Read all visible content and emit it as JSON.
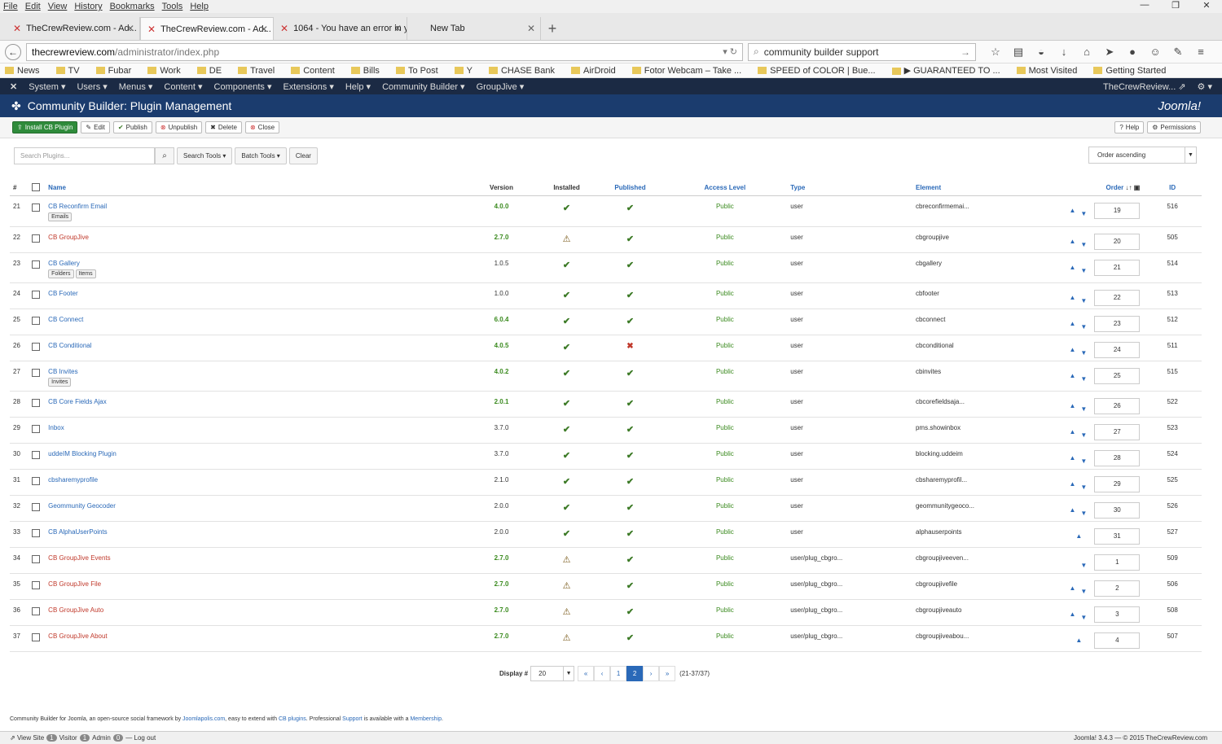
{
  "browser": {
    "menu": [
      "File",
      "Edit",
      "View",
      "History",
      "Bookmarks",
      "Tools",
      "Help"
    ],
    "tabs": [
      {
        "label": "TheCrewReview.com - Ad...",
        "active": false
      },
      {
        "label": "TheCrewReview.com - Ad...",
        "active": true
      },
      {
        "label": "1064 - You have an error in yo...",
        "active": false
      },
      {
        "label": "New Tab",
        "active": false
      }
    ],
    "url_host": "thecrewreview.com",
    "url_path": "/administrator/index.php",
    "search": "community builder support",
    "bookmarks": [
      "News",
      "TV",
      "Fubar",
      "Work",
      "DE",
      "Travel",
      "Content",
      "Bills",
      "To Post",
      "Y",
      "CHASE Bank",
      "AirDroid",
      "Fotor Webcam – Take ...",
      "SPEED of COLOR | Bue...",
      "▶ GUARANTEED TO ...",
      "Most Visited",
      "Getting Started"
    ]
  },
  "joomla": {
    "menu": [
      "System",
      "Users",
      "Menus",
      "Content",
      "Components",
      "Extensions",
      "Help",
      "Community Builder",
      "GroupJive"
    ],
    "site": "TheCrewReview...",
    "title": "Community Builder: Plugin Management",
    "logo": "Joomla!"
  },
  "toolbar": {
    "install": "Install CB Plugin",
    "edit": "Edit",
    "publish": "Publish",
    "unpublish": "Unpublish",
    "delete": "Delete",
    "close": "Close",
    "help": "Help",
    "permissions": "Permissions"
  },
  "filters": {
    "search_placeholder": "Search Plugins...",
    "search_tools": "Search Tools",
    "batch_tools": "Batch Tools",
    "clear": "Clear",
    "ordering": "Order ascending"
  },
  "columns": {
    "num": "#",
    "name": "Name",
    "version": "Version",
    "installed": "Installed",
    "published": "Published",
    "access": "Access Level",
    "type": "Type",
    "element": "Element",
    "order": "Order",
    "id": "ID"
  },
  "rows": [
    {
      "n": "21",
      "name": "CB Reconfirm Email",
      "red": false,
      "tags": [
        "Emails"
      ],
      "ver": "4.0.0",
      "vg": true,
      "inst": "ok",
      "pub": "ok",
      "acc": "Public",
      "type": "user",
      "el": "cbreconfirmemai...",
      "up": true,
      "down": true,
      "ord": "19",
      "id": "516"
    },
    {
      "n": "22",
      "name": "CB GroupJive",
      "red": true,
      "tags": [],
      "ver": "2.7.0",
      "vg": true,
      "inst": "warn",
      "pub": "ok",
      "acc": "Public",
      "type": "user",
      "el": "cbgroupjive",
      "up": true,
      "down": true,
      "ord": "20",
      "id": "505"
    },
    {
      "n": "23",
      "name": "CB Gallery",
      "red": false,
      "tags": [
        "Folders",
        "Items"
      ],
      "ver": "1.0.5",
      "vg": false,
      "inst": "ok",
      "pub": "ok",
      "acc": "Public",
      "type": "user",
      "el": "cbgallery",
      "up": true,
      "down": true,
      "ord": "21",
      "id": "514"
    },
    {
      "n": "24",
      "name": "CB Footer",
      "red": false,
      "tags": [],
      "ver": "1.0.0",
      "vg": false,
      "inst": "ok",
      "pub": "ok",
      "acc": "Public",
      "type": "user",
      "el": "cbfooter",
      "up": true,
      "down": true,
      "ord": "22",
      "id": "513"
    },
    {
      "n": "25",
      "name": "CB Connect",
      "red": false,
      "tags": [],
      "ver": "6.0.4",
      "vg": true,
      "inst": "ok",
      "pub": "ok",
      "acc": "Public",
      "type": "user",
      "el": "cbconnect",
      "up": true,
      "down": true,
      "ord": "23",
      "id": "512"
    },
    {
      "n": "26",
      "name": "CB Conditional",
      "red": false,
      "tags": [],
      "ver": "4.0.5",
      "vg": true,
      "inst": "ok",
      "pub": "err",
      "acc": "Public",
      "type": "user",
      "el": "cbconditional",
      "up": true,
      "down": true,
      "ord": "24",
      "id": "511"
    },
    {
      "n": "27",
      "name": "CB Invites",
      "red": false,
      "tags": [
        "Invites"
      ],
      "ver": "4.0.2",
      "vg": true,
      "inst": "ok",
      "pub": "ok",
      "acc": "Public",
      "type": "user",
      "el": "cbinvites",
      "up": true,
      "down": true,
      "ord": "25",
      "id": "515"
    },
    {
      "n": "28",
      "name": "CB Core Fields Ajax",
      "red": false,
      "tags": [],
      "ver": "2.0.1",
      "vg": true,
      "inst": "ok",
      "pub": "ok",
      "acc": "Public",
      "type": "user",
      "el": "cbcorefieldsaja...",
      "up": true,
      "down": true,
      "ord": "26",
      "id": "522"
    },
    {
      "n": "29",
      "name": "Inbox",
      "red": false,
      "tags": [],
      "ver": "3.7.0",
      "vg": false,
      "inst": "ok",
      "pub": "ok",
      "acc": "Public",
      "type": "user",
      "el": "pms.showinbox",
      "up": true,
      "down": true,
      "ord": "27",
      "id": "523"
    },
    {
      "n": "30",
      "name": "uddeIM Blocking Plugin",
      "red": false,
      "tags": [],
      "ver": "3.7.0",
      "vg": false,
      "inst": "ok",
      "pub": "ok",
      "acc": "Public",
      "type": "user",
      "el": "blocking.uddeim",
      "up": true,
      "down": true,
      "ord": "28",
      "id": "524"
    },
    {
      "n": "31",
      "name": "cbsharemyprofile",
      "red": false,
      "tags": [],
      "ver": "2.1.0",
      "vg": false,
      "inst": "ok",
      "pub": "ok",
      "acc": "Public",
      "type": "user",
      "el": "cbsharemyprofil...",
      "up": true,
      "down": true,
      "ord": "29",
      "id": "525"
    },
    {
      "n": "32",
      "name": "Geommunity Geocoder",
      "red": false,
      "tags": [],
      "ver": "2.0.0",
      "vg": false,
      "inst": "ok",
      "pub": "ok",
      "acc": "Public",
      "type": "user",
      "el": "geommunitygeoco...",
      "up": true,
      "down": true,
      "ord": "30",
      "id": "526"
    },
    {
      "n": "33",
      "name": "CB AlphaUserPoints",
      "red": false,
      "tags": [],
      "ver": "2.0.0",
      "vg": false,
      "inst": "ok",
      "pub": "ok",
      "acc": "Public",
      "type": "user",
      "el": "alphauserpoints",
      "up": true,
      "down": false,
      "ord": "31",
      "id": "527"
    },
    {
      "n": "34",
      "name": "CB GroupJive Events",
      "red": true,
      "tags": [],
      "ver": "2.7.0",
      "vg": true,
      "inst": "warn",
      "pub": "ok",
      "acc": "Public",
      "type": "user/plug_cbgro...",
      "el": "cbgroupjiveeven...",
      "up": false,
      "down": true,
      "ord": "1",
      "id": "509"
    },
    {
      "n": "35",
      "name": "CB GroupJive File",
      "red": true,
      "tags": [],
      "ver": "2.7.0",
      "vg": true,
      "inst": "warn",
      "pub": "ok",
      "acc": "Public",
      "type": "user/plug_cbgro...",
      "el": "cbgroupjivefile",
      "up": true,
      "down": true,
      "ord": "2",
      "id": "506"
    },
    {
      "n": "36",
      "name": "CB GroupJive Auto",
      "red": true,
      "tags": [],
      "ver": "2.7.0",
      "vg": true,
      "inst": "warn",
      "pub": "ok",
      "acc": "Public",
      "type": "user/plug_cbgro...",
      "el": "cbgroupjiveauto",
      "up": true,
      "down": true,
      "ord": "3",
      "id": "508"
    },
    {
      "n": "37",
      "name": "CB GroupJive About",
      "red": true,
      "tags": [],
      "ver": "2.7.0",
      "vg": true,
      "inst": "warn",
      "pub": "ok",
      "acc": "Public",
      "type": "user/plug_cbgro...",
      "el": "cbgroupjiveabou...",
      "up": true,
      "down": false,
      "ord": "4",
      "id": "507"
    }
  ],
  "pagination": {
    "label": "Display #",
    "limit": "20",
    "pages": [
      "«",
      "‹",
      "1",
      "2",
      "›",
      "»"
    ],
    "active": "2",
    "range": "(21-37/37)"
  },
  "footer": {
    "t1": "Community Builder for Joomla, an open-source social framework by ",
    "l1": "Joomlapolis.com",
    "t2": ", easy to extend with ",
    "l2": "CB plugins",
    "t3": ". Professional ",
    "l3": "Support",
    "t4": " is available with a ",
    "l4": "Membership",
    "t5": "."
  },
  "status": {
    "view_site": "View Site",
    "visitors_count": "1",
    "visitor": "Visitor",
    "admins_count": "1",
    "admin": "Admin",
    "msgs_count": "0",
    "logout": "Log out",
    "version": "Joomla! 3.4.3 — © 2015 TheCrewReview.com"
  }
}
